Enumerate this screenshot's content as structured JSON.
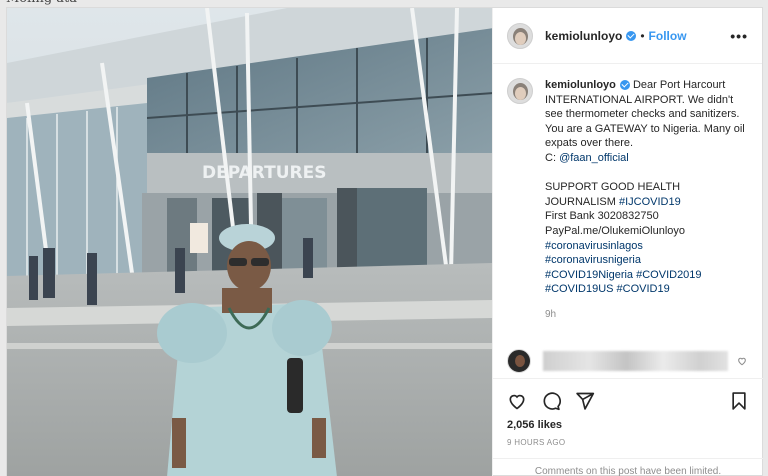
{
  "post": {
    "username": "kemiolunloyo",
    "follow_label": "Follow",
    "dot": "•",
    "more_label": "•••",
    "photo_sign_text": "DEPARTURES",
    "caption": {
      "line1": "Dear Port Harcourt INTERNATIONAL AIRPORT. We didn't see thermometer checks and sanitizers. You are a GATEWAY to Nigeria. Many oil expats over there.",
      "credit_prefix": "C: ",
      "credit_handle": "@faan_official",
      "support_line": "SUPPORT GOOD HEALTH JOURNALISM ",
      "support_tag": "#IJCOVID19",
      "bank_line": "First Bank 3020832750",
      "paypal_line": "PayPal.me/OlukemiOlunloyo",
      "tags": [
        "#coronavirusinlagos",
        "#coronavirusnigeria",
        "#COVID19Nigeria",
        "#COVID2019",
        "#COVID19US",
        "#COVID19"
      ]
    },
    "caption_time": "9h",
    "likes": "2,056 likes",
    "time_ago": "9 HOURS AGO",
    "comments_notice": "Comments on this post have been limited."
  }
}
